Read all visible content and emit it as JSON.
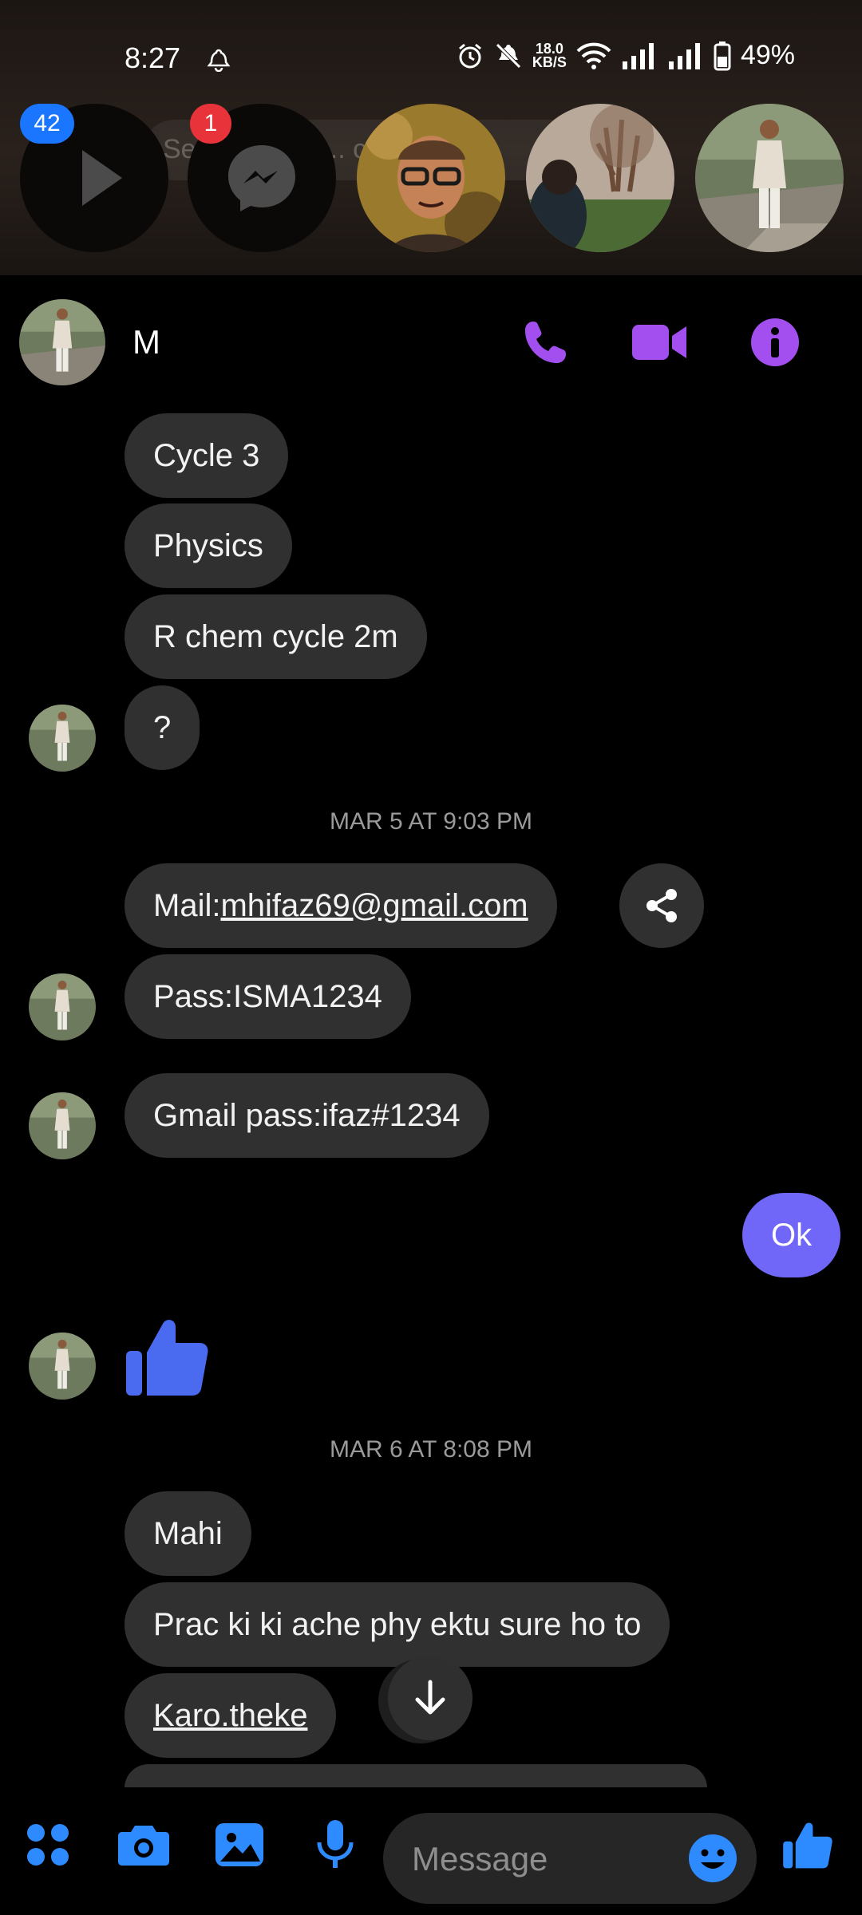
{
  "status_bar": {
    "time": "8:27",
    "net_speed_value": "18.0",
    "net_speed_unit": "KB/S",
    "battery": "49%"
  },
  "chat_heads": {
    "search_ghost": "Search ... os ... c",
    "badges": [
      "42",
      "1"
    ]
  },
  "header": {
    "name": "M"
  },
  "messages": {
    "m1": "Cycle 3",
    "m2": "Physics",
    "m3": "R chem cycle 2m",
    "m4": "?",
    "stamp1": "MAR 5 AT 9:03 PM",
    "m5_prefix": "Mail:",
    "m5_link": "mhifaz69@gmail.com",
    "m6": "Pass:ISMA1234",
    "m7": "Gmail pass:ifaz#1234",
    "mine1": "Ok",
    "stamp2": "MAR 6 AT 8:08 PM",
    "m8": "Mahi",
    "m9": "Prac ki ki ache phy ektu sure ho to",
    "m10_link": "Karo.theke"
  },
  "composer": {
    "placeholder": "Message"
  },
  "colors": {
    "accent_purple": "#a34ff0",
    "my_bubble": "#7066f7",
    "their_bubble": "#303030",
    "blue_icon": "#2e8bff",
    "like_blue": "#4a6bf0"
  }
}
